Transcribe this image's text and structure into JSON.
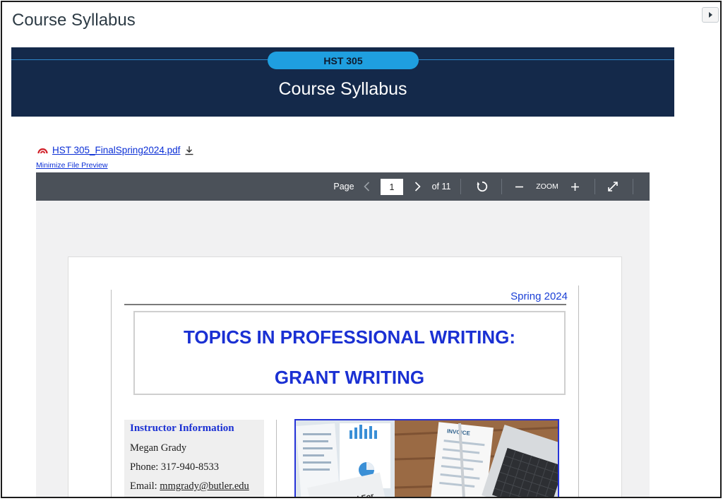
{
  "page": {
    "title": "Course Syllabus"
  },
  "banner": {
    "course_code": "HST 305",
    "title": "Course Syllabus"
  },
  "file": {
    "name": "HST 305_FinalSpring2024.pdf",
    "minimize_label": "Minimize File Preview"
  },
  "viewer": {
    "page_label": "Page",
    "current_page": "1",
    "total_label": "of 11",
    "zoom_label": "ZOOM"
  },
  "document": {
    "semester": "Spring 2024",
    "title_line1": "TOPICS IN PROFESSIONAL WRITING:",
    "title_line2": "GRANT WRITING",
    "instructor": {
      "heading": "Instructor Information",
      "name": "Megan Grady",
      "phone": "Phone: 317-940-8533",
      "email_label": "Email: ",
      "email": "mmgrady@butler.edu"
    },
    "photo_text": {
      "tax_form": "Tax Refund For",
      "invoice": "INVOICE"
    }
  },
  "colors": {
    "banner_bg": "#14294a",
    "pill_bg": "#1f9fe0",
    "link": "#0b2fd6",
    "doc_title": "#1a30d3",
    "toolbar_bg": "#4b5159"
  }
}
